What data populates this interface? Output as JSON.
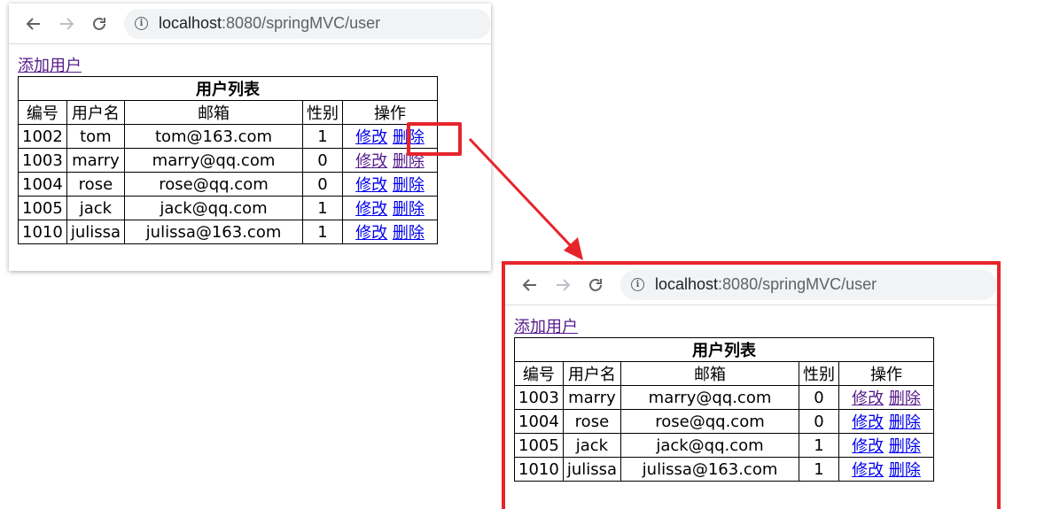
{
  "before": {
    "url_host": "localhost",
    "url_rest": ":8080/springMVC/user",
    "add_user_link": "添加用户",
    "table_title": "用户列表",
    "headers": [
      "编号",
      "用户名",
      "邮箱",
      "性别",
      "操作"
    ],
    "rows": [
      {
        "id": "1002",
        "name": "tom",
        "email": "tom@163.com",
        "gender": "1",
        "edit": "修改",
        "delete": "删除"
      },
      {
        "id": "1003",
        "name": "marry",
        "email": "marry@qq.com",
        "gender": "0",
        "edit": "修改",
        "delete": "删除"
      },
      {
        "id": "1004",
        "name": "rose",
        "email": "rose@qq.com",
        "gender": "0",
        "edit": "修改",
        "delete": "删除"
      },
      {
        "id": "1005",
        "name": "jack",
        "email": "jack@qq.com",
        "gender": "1",
        "edit": "修改",
        "delete": "删除"
      },
      {
        "id": "1010",
        "name": "julissa",
        "email": "julissa@163.com",
        "gender": "1",
        "edit": "修改",
        "delete": "删除"
      }
    ]
  },
  "after": {
    "url_host": "localhost",
    "url_rest": ":8080/springMVC/user",
    "add_user_link": "添加用户",
    "table_title": "用户列表",
    "headers": [
      "编号",
      "用户名",
      "邮箱",
      "性别",
      "操作"
    ],
    "rows": [
      {
        "id": "1003",
        "name": "marry",
        "email": "marry@qq.com",
        "gender": "0",
        "edit": "修改",
        "delete": "删除"
      },
      {
        "id": "1004",
        "name": "rose",
        "email": "rose@qq.com",
        "gender": "0",
        "edit": "修改",
        "delete": "删除"
      },
      {
        "id": "1005",
        "name": "jack",
        "email": "jack@qq.com",
        "gender": "1",
        "edit": "修改",
        "delete": "删除"
      },
      {
        "id": "1010",
        "name": "julissa",
        "email": "julissa@163.com",
        "gender": "1",
        "edit": "修改",
        "delete": "删除"
      }
    ]
  },
  "icons": {
    "back": "back-arrow-icon",
    "forward": "forward-arrow-icon",
    "reload": "reload-icon",
    "info": "info-icon"
  },
  "colors": {
    "annotation": "#e6252b",
    "link": "#0000ee",
    "visited_link": "#551a8b"
  }
}
